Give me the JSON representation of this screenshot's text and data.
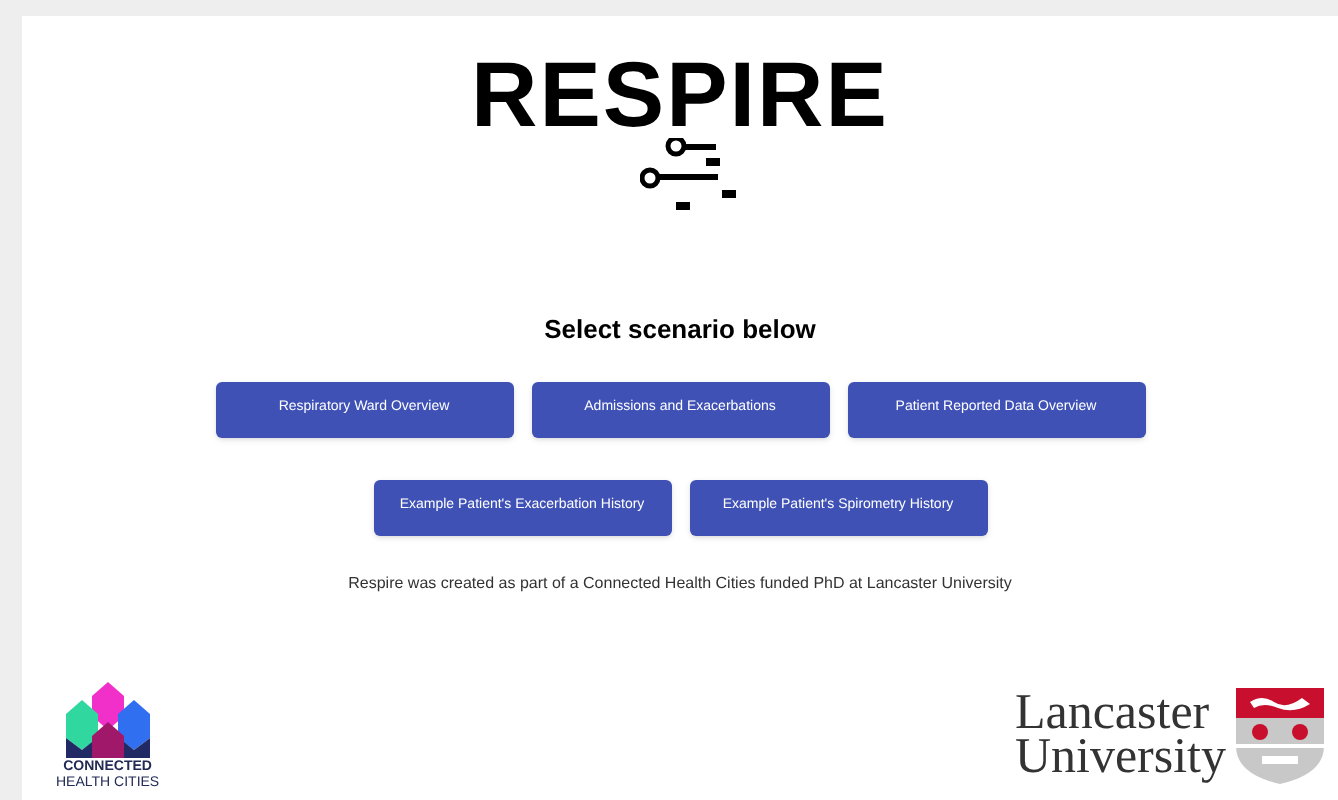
{
  "logo": {
    "text": "RESPIRE"
  },
  "heading": "Select scenario below",
  "button_rows": [
    [
      "Respiratory Ward Overview",
      "Admissions and Exacerbations",
      "Patient Reported Data Overview"
    ],
    [
      "Example Patient's Exacerbation History",
      "Example Patient's Spirometry History"
    ]
  ],
  "footnote": "Respire was created as part of a Connected Health Cities funded PhD at Lancaster University",
  "partner_logo": {
    "line_1": "CONNECTED",
    "line_2": "HEALTH CITIES"
  },
  "university_logo": {
    "line_1": "Lancaster",
    "line_2": "University"
  }
}
